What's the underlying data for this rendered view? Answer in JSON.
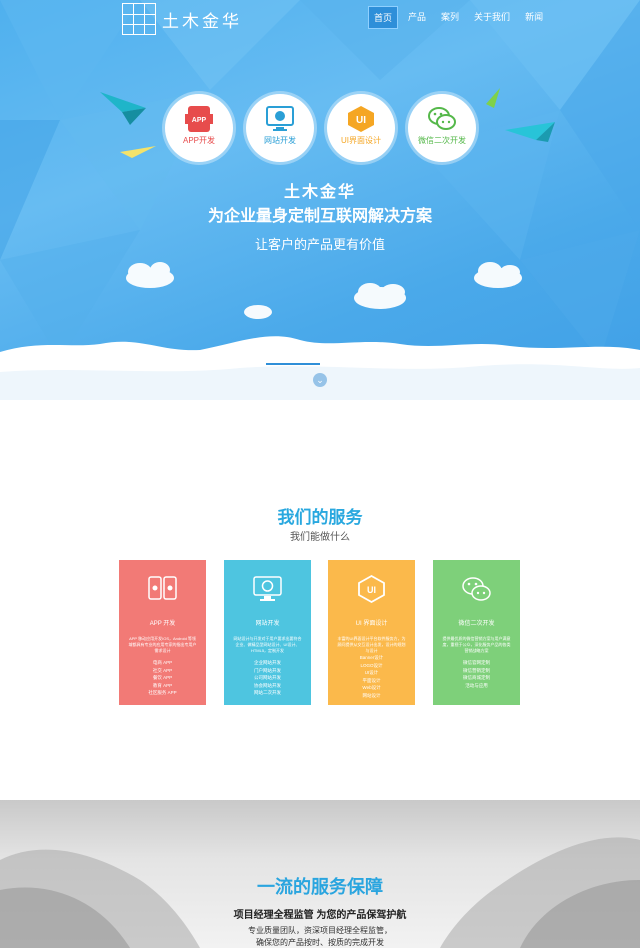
{
  "header": {
    "logo_text": "土木金华",
    "nav": [
      {
        "label": "首页",
        "active": true
      },
      {
        "label": "产品",
        "active": false
      },
      {
        "label": "案列",
        "active": false
      },
      {
        "label": "关于我们",
        "active": false
      },
      {
        "label": "新闻",
        "active": false
      }
    ]
  },
  "hero": {
    "bubbles": [
      {
        "label": "APP开发",
        "icon": "app-icon",
        "color": "#e74c4c",
        "badge": "APP"
      },
      {
        "label": "网站开发",
        "icon": "monitor-globe-icon",
        "color": "#2a9fd6",
        "badge": ""
      },
      {
        "label": "UI界面设计",
        "icon": "ui-badge-icon",
        "color": "#f5a623",
        "badge": "UI"
      },
      {
        "label": "微信二次开发",
        "icon": "wechat-icon",
        "color": "#55b84a",
        "badge": ""
      }
    ],
    "title": "土木金华",
    "slogan": "为企业量身定制互联网解决方案",
    "tagline": "让客户的产品更有价值",
    "slider_active_index": 1,
    "slider_count": 3
  },
  "services": {
    "title": "我们的服务",
    "subtitle": "我们能做什么",
    "cards": [
      {
        "title": "APP 开发",
        "color": "#f27a76",
        "icon": "mobile-devices-icon",
        "desc": "APP 移动应用开发IOS，Android 等领域都具有专业的应用专家的指出专用户需求设计",
        "items": [
          "电商 APP",
          "社交 APP",
          "餐饮 APP",
          "教育 APP",
          "社区服务 APP"
        ]
      },
      {
        "title": "网站开发",
        "color": "#4ec5e0",
        "icon": "monitor-globe-icon",
        "desc": "网站设计与开发对于用户要求出要符合企业、做精品型网站设计、UI设计、HTML5，定制开发",
        "items": [
          "企业网站开发",
          "门户网站开发",
          "公司网站开发",
          "协会网站开发",
          "网站二次开发"
        ]
      },
      {
        "title": "UI 界面设计",
        "color": "#fbb94b",
        "icon": "ui-badge-icon",
        "desc": "丰富的UI界面设计平台软件服务方，为顾问提供从交互设计出发，设计的规划与设计",
        "items": [
          "Banner设计",
          "LOGO设计",
          "UI设计",
          "平面设计",
          "Web设计",
          "网站设计"
        ]
      },
      {
        "title": "微信二次开发",
        "color": "#7ed07a",
        "icon": "wechat-icon",
        "desc": "提供最优质的微信营销方案与用户满意度，重视于公众，深化服务产品的各类营销战略方案",
        "items": [
          "微信官网定制",
          "微信营销定制",
          "微信商城定制",
          "活动与应用"
        ]
      }
    ]
  },
  "guarantee": {
    "title": "一流的服务保障",
    "subtitle": "项目经理全程监管 为您的产品保驾护航",
    "lines": [
      "专业质量团队，资深项目经理全程监管，",
      "确保您的产品按时、按质的完成开发"
    ]
  },
  "colors": {
    "hero_blue": "#4fb0ee",
    "accent": "#29a8df",
    "nav_active": "#2e8fd9"
  }
}
